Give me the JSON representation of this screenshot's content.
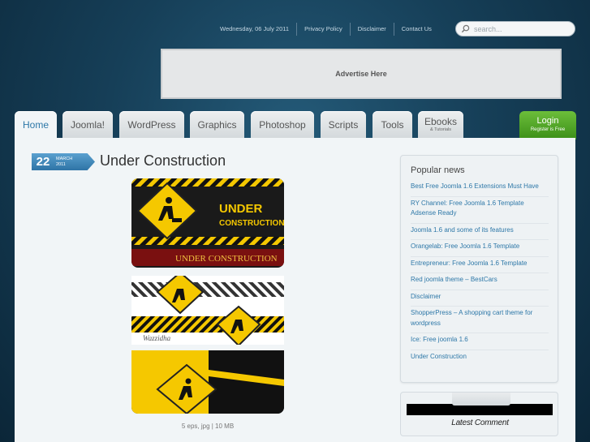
{
  "topbar": {
    "date": "Wednesday, 06 July 2011",
    "links": [
      "Privacy Policy",
      "Disclaimer",
      "Contact Us"
    ]
  },
  "search": {
    "placeholder": "search..."
  },
  "ad": {
    "label": "Advertise Here"
  },
  "nav": {
    "tabs": [
      {
        "label": "Home",
        "active": true
      },
      {
        "label": "Joomla!"
      },
      {
        "label": "WordPress"
      },
      {
        "label": "Graphics"
      },
      {
        "label": "Photoshop"
      },
      {
        "label": "Scripts"
      },
      {
        "label": "Tools"
      },
      {
        "label": "Ebooks",
        "sub": "& Tutorials"
      }
    ],
    "login": {
      "label": "Login",
      "sub": "Register is Free"
    }
  },
  "post": {
    "day": "22",
    "month": "MARCH",
    "year": "2011",
    "title": "Under Construction",
    "image_text": "UNDER CONSTRUCTION",
    "image_text2": "UNDER CONSTRUCTION",
    "caption": "5 eps, jpg | 10 MB"
  },
  "sidebar": {
    "title": "Popular news",
    "items": [
      "Best Free Joomla 1.6 Extensions Must Have",
      "RY Channel: Free Joomla 1.6 Template Adsense Ready",
      "Joomla 1.6 and some of its features",
      "Orangelab: Free Joomla 1.6 Template",
      "Entrepreneur: Free Joomla 1.6 Template",
      "Red joomla theme – BestCars",
      "Disclaimer",
      "ShopperPress – A shopping cart theme for wordpress",
      "Ice: Free joomla 1.6",
      "Under Construction"
    ]
  },
  "latest": {
    "label": "Latest Comment"
  },
  "colors": {
    "accent": "#2e78a8",
    "login_green": "#4fa626",
    "warning_yellow": "#f5c800"
  }
}
